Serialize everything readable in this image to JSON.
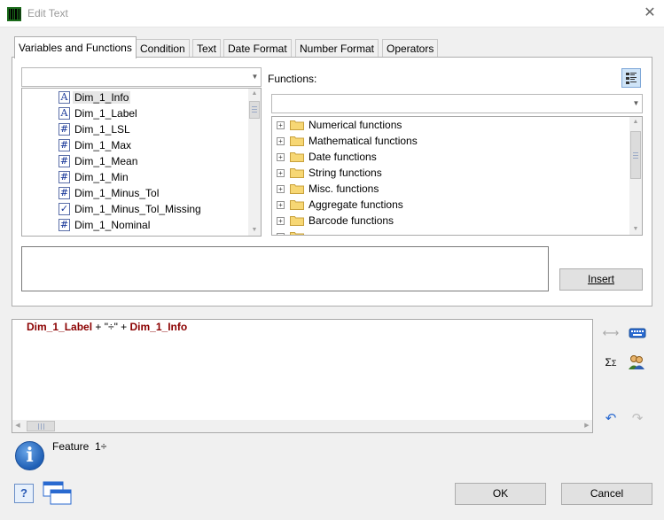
{
  "window": {
    "title": "Edit Text",
    "close": "✕"
  },
  "tabs": [
    {
      "label": "Variables and Functions",
      "active": true
    },
    {
      "label": "Condition"
    },
    {
      "label": "Text"
    },
    {
      "label": "Date Format"
    },
    {
      "label": "Number Format"
    },
    {
      "label": "Operators"
    }
  ],
  "variables": {
    "items": [
      {
        "label": "Dim_1_Info",
        "icon": "A",
        "selected": true
      },
      {
        "label": "Dim_1_Label",
        "icon": "A"
      },
      {
        "label": "Dim_1_LSL",
        "icon": "#"
      },
      {
        "label": "Dim_1_Max",
        "icon": "#"
      },
      {
        "label": "Dim_1_Mean",
        "icon": "#"
      },
      {
        "label": "Dim_1_Min",
        "icon": "#"
      },
      {
        "label": "Dim_1_Minus_Tol",
        "icon": "#"
      },
      {
        "label": "Dim_1_Minus_Tol_Missing",
        "icon": "✓"
      },
      {
        "label": "Dim_1_Nominal",
        "icon": "#"
      }
    ]
  },
  "functions": {
    "label": "Functions:",
    "items": [
      {
        "label": "Numerical functions"
      },
      {
        "label": "Mathematical functions"
      },
      {
        "label": "Date functions"
      },
      {
        "label": "String functions"
      },
      {
        "label": "Misc. functions"
      },
      {
        "label": "Aggregate functions"
      },
      {
        "label": "Barcode functions"
      }
    ]
  },
  "buttons": {
    "insert": "Insert",
    "ok": "OK",
    "cancel": "Cancel"
  },
  "formula": {
    "tokens": [
      {
        "text": "Dim_1_Label",
        "kind": "var"
      },
      {
        "text": " + \"÷\" + ",
        "kind": "op"
      },
      {
        "text": "Dim_1_Info",
        "kind": "var"
      }
    ]
  },
  "info": {
    "text": "Feature  1÷"
  },
  "icons": {
    "app": "app-barcode-icon",
    "view_toggle": "list-view-icon",
    "wrap": "wrap-icon",
    "keyboard": "keyboard-icon",
    "sum": "sum-icon",
    "users": "users-icon",
    "undo": "undo-icon",
    "redo": "redo-icon",
    "help": "help-icon",
    "windows": "windows-icon",
    "info": "info-icon"
  },
  "colors": {
    "variable": "#8b0000",
    "accent": "#1f5fb5"
  }
}
